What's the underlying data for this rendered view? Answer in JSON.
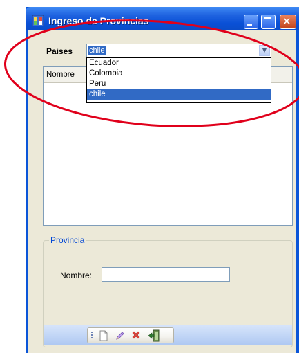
{
  "window": {
    "title": "Ingreso de Provincias",
    "icons": {
      "app": "app-window-icon",
      "minimize": "minimize-icon",
      "maximize": "maximize-icon",
      "close": "close-icon"
    },
    "close_glyph": "✕"
  },
  "paises": {
    "label": "Paises",
    "selected": "chile",
    "options": [
      "Ecuador",
      "Colombia",
      "Peru",
      "chile"
    ]
  },
  "grid": {
    "columns": [
      "Nombre"
    ]
  },
  "provincia": {
    "title": "Provincia",
    "nombre_label": "Nombre:",
    "nombre_value": ""
  },
  "toolbar": {
    "icons": [
      "new-document-icon",
      "edit-pencil-icon",
      "delete-x-icon",
      "exit-door-icon"
    ]
  },
  "colors": {
    "accent": "#0a55d8",
    "selection": "#316ac5",
    "annotation": "#e0001b"
  }
}
